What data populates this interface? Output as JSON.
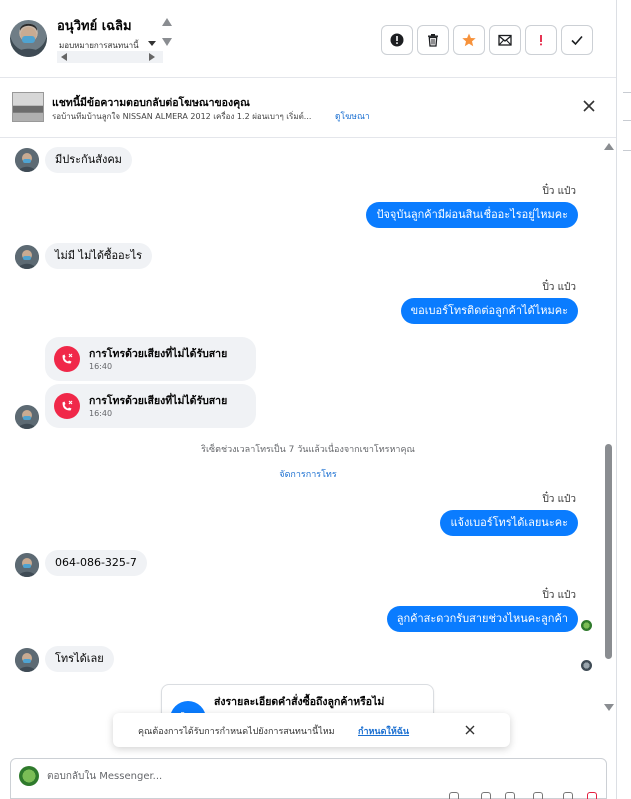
{
  "header": {
    "contact_name": "อนุวิทย์ เฉลิม",
    "assign_label": "มอบหมายการสนทนานี้",
    "actions": [
      {
        "name": "report-spam-button",
        "icon": "alert-circle-icon"
      },
      {
        "name": "delete-button",
        "icon": "trash-icon"
      },
      {
        "name": "star-button",
        "icon": "star-icon"
      },
      {
        "name": "mark-unread-button",
        "icon": "envelope-icon"
      },
      {
        "name": "follow-up-button",
        "icon": "exclamation-icon"
      },
      {
        "name": "mark-done-button",
        "icon": "check-icon"
      }
    ]
  },
  "ad_banner": {
    "title": "แชทนี้มีข้อความตอบกลับต่อโฆษณาของคุณ",
    "subtitle": "รอบ้านทีมบ้านลูกใจ NISSAN ALMERA 2012 เครื่อง 1.2 ผ่อนเบาๆ เริ่มต์...",
    "link": "ดูโฆษณา"
  },
  "messages": {
    "m1": "มีประกันสังคม",
    "s1": "ปิ๋ว แป๋ว",
    "m2": "ปัจจุบันลูกค้ามีผ่อนสินเชื่ออะไรอยู่ไหมคะ",
    "m3": "ไม่มี ไม่ได้ซื้ออะไร",
    "s2": "ปิ๋ว แป๋ว",
    "m4": "ขอเบอร์โทรติดต่อลูกค้าได้ไหมคะ",
    "call1_title": "การโทรด้วยเสียงที่ไม่ได้รับสาย",
    "call1_time": "16:40",
    "call2_title": "การโทรด้วยเสียงที่ไม่ได้รับสาย",
    "call2_time": "16:40",
    "note": "ริเซ็ตช่วงเวลาโทรเป็น 7 วันแล้วเนื่องจากเขาโทรหาคุณ",
    "note_link": "จัดการการโทร",
    "s3": "ปิ๋ว แป๋ว",
    "m5": "แจ้งเบอร์โทรได้เลยนะคะ",
    "m6": "064-086-325-7",
    "s4": "ปิ๋ว แป๋ว",
    "m7": "ลูกค้าสะดวกรับสายช่วงไหนคะลูกค้า",
    "m8": "โทรได้เลย",
    "order_card": "ส่งรายละเอียดคำสั่งซื้อถึงลูกค้าหรือไม่"
  },
  "toast": {
    "text": "คุณต้องการได้รับการกำหนดไปยังการสนทนานี้ไหม",
    "link": "กำหนดให้ฉัน"
  },
  "composer": {
    "placeholder": "ตอบกลับใน Messenger..."
  },
  "colors": {
    "outgoing_bubble": "#0a7cff",
    "incoming_bubble": "#f0f2f5",
    "link": "#1a6fd1",
    "missed_call": "#f02849",
    "star": "#f7923b"
  }
}
